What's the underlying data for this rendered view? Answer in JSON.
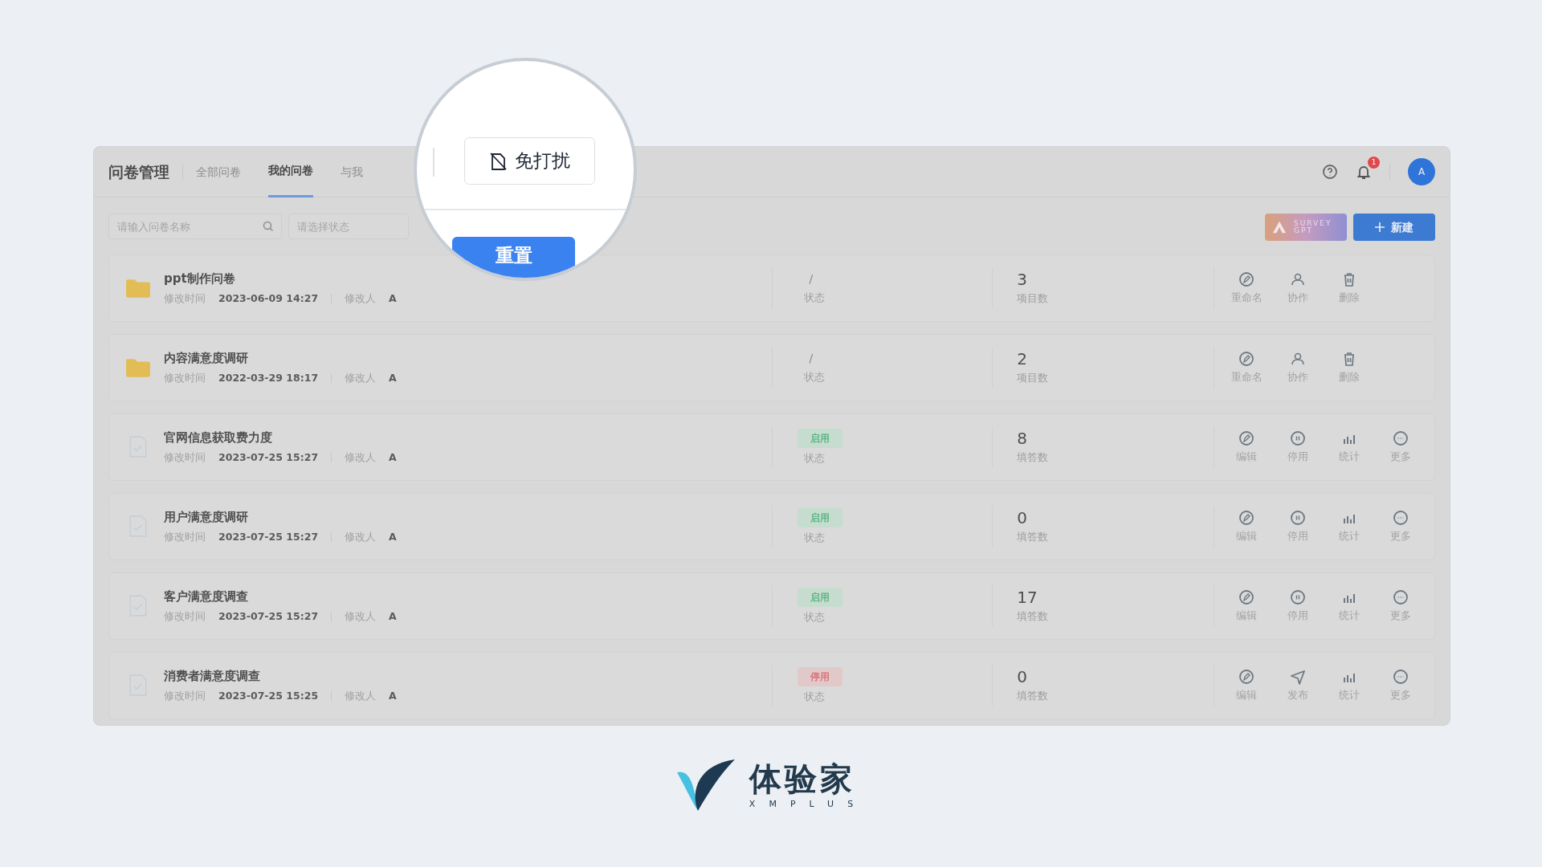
{
  "app": {
    "title": "问卷管理",
    "tabs": [
      {
        "label": "全部问卷",
        "selected": false
      },
      {
        "label": "我的问卷",
        "selected": true
      },
      {
        "label": "与我",
        "selected": false
      }
    ],
    "notification_count": "1",
    "avatar": "A",
    "search": {
      "placeholder": "请输入问卷名称"
    },
    "status_filter": {
      "placeholder": "请选择状态"
    },
    "gpt_button": {
      "line_1": "SURVEY",
      "line_2": "GPT"
    },
    "new_button": "新建",
    "rows": [
      {
        "kind": "folder",
        "name": "ppt制作问卷",
        "modified_label": "修改时间",
        "modified": "2023-06-09 14:27",
        "editor_label": "修改人",
        "editor": "A",
        "status": {
          "kind": "plain",
          "text": "/"
        },
        "status_label": "状态",
        "count": "3",
        "count_label": "项目数",
        "actions": [
          {
            "kind": "edit",
            "label": "重命名"
          },
          {
            "kind": "team",
            "label": "协作"
          },
          {
            "kind": "trash",
            "label": "删除"
          }
        ]
      },
      {
        "kind": "folder",
        "name": "内容满意度调研",
        "modified_label": "修改时间",
        "modified": "2022-03-29 18:17",
        "editor_label": "修改人",
        "editor": "A",
        "status": {
          "kind": "plain",
          "text": "/"
        },
        "status_label": "状态",
        "count": "2",
        "count_label": "项目数",
        "actions": [
          {
            "kind": "edit",
            "label": "重命名"
          },
          {
            "kind": "team",
            "label": "协作"
          },
          {
            "kind": "trash",
            "label": "删除"
          }
        ]
      },
      {
        "kind": "survey",
        "name": "官网信息获取费力度",
        "modified_label": "修改时间",
        "modified": "2023-07-25 15:27",
        "editor_label": "修改人",
        "editor": "A",
        "status": {
          "kind": "enabled",
          "text": "启用"
        },
        "status_label": "状态",
        "count": "8",
        "count_label": "填答数",
        "actions": [
          {
            "kind": "edit",
            "label": "编辑"
          },
          {
            "kind": "pause",
            "label": "停用"
          },
          {
            "kind": "chart",
            "label": "统计"
          },
          {
            "kind": "more",
            "label": "更多"
          }
        ]
      },
      {
        "kind": "survey",
        "name": "用户满意度调研",
        "modified_label": "修改时间",
        "modified": "2023-07-25 15:27",
        "editor_label": "修改人",
        "editor": "A",
        "status": {
          "kind": "enabled",
          "text": "启用"
        },
        "status_label": "状态",
        "count": "0",
        "count_label": "填答数",
        "actions": [
          {
            "kind": "edit",
            "label": "编辑"
          },
          {
            "kind": "pause",
            "label": "停用"
          },
          {
            "kind": "chart",
            "label": "统计"
          },
          {
            "kind": "more",
            "label": "更多"
          }
        ]
      },
      {
        "kind": "survey",
        "name": "客户满意度调查",
        "modified_label": "修改时间",
        "modified": "2023-07-25 15:27",
        "editor_label": "修改人",
        "editor": "A",
        "status": {
          "kind": "enabled",
          "text": "启用"
        },
        "status_label": "状态",
        "count": "17",
        "count_label": "填答数",
        "actions": [
          {
            "kind": "edit",
            "label": "编辑"
          },
          {
            "kind": "pause",
            "label": "停用"
          },
          {
            "kind": "chart",
            "label": "统计"
          },
          {
            "kind": "more",
            "label": "更多"
          }
        ]
      },
      {
        "kind": "survey",
        "name": "消费者满意度调查",
        "modified_label": "修改时间",
        "modified": "2023-07-25 15:25",
        "editor_label": "修改人",
        "editor": "A",
        "status": {
          "kind": "disabled",
          "text": "停用"
        },
        "status_label": "状态",
        "count": "0",
        "count_label": "填答数",
        "actions": [
          {
            "kind": "edit",
            "label": "编辑"
          },
          {
            "kind": "send",
            "label": "发布"
          },
          {
            "kind": "chart",
            "label": "统计"
          },
          {
            "kind": "more",
            "label": "更多"
          }
        ]
      }
    ]
  },
  "magnifier": {
    "dnd_button": "免打扰",
    "reset_button": "重置"
  },
  "brand": {
    "name": "体验家",
    "tagline": "XMPLUS"
  }
}
